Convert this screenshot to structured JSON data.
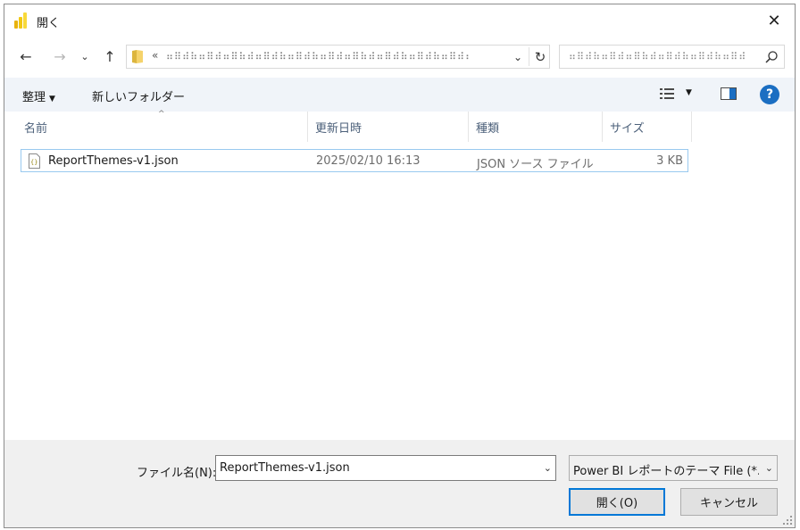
{
  "window": {
    "title": "開く"
  },
  "titlebar": {
    "close_glyph": "✕"
  },
  "nav": {
    "back_glyph": "←",
    "forward_glyph": "→",
    "recent_glyph": "⌄",
    "up_glyph": "↑",
    "address_chevron": "«",
    "address_path": "⠶⠿⠾⠷⠶⠿⠾⠶⠿⠷⠾⠶⠿⠾⠷⠶⠿⠾⠷⠶⠿⠾⠶⠿⠷⠾⠶⠿⠾⠷⠶⠿⠾⠷⠶⠿⠾⠶⠿⠷⠾⠶⠿⠾⠷⠶",
    "address_dropdown_glyph": "⌄",
    "refresh_glyph": "↻",
    "search_text": "⠶⠿⠾⠷⠶⠿⠾⠶⠿⠷⠾⠶⠿⠾⠷⠶⠿⠾⠷⠶⠿⠾⠶⠿⠷⠾⠶"
  },
  "command_bar": {
    "organize_label": "整理",
    "new_folder_label": "新しいフォルダー",
    "help_glyph": "?"
  },
  "file_list": {
    "columns": {
      "name": "名前",
      "date": "更新日時",
      "type": "種類",
      "size": "サイズ"
    },
    "sort_glyph": "^",
    "rows": [
      {
        "name": "ReportThemes-v1.json",
        "date": "2025/02/10 16:13",
        "type": "JSON ソース ファイル",
        "size": "3 KB"
      }
    ]
  },
  "bottom": {
    "filename_label": "ファイル名(N):",
    "filename_value": "ReportThemes-v1.json",
    "filter_value": "Power BI レポートのテーマ File (*.json)",
    "dropdown_glyph": "⌄",
    "open_button": "開く(O)",
    "cancel_button": "キャンセル"
  },
  "colors": {
    "accent": "#0078d7",
    "help": "#1b6ec2",
    "powerbi_yellow": "#f2c811",
    "selection_border": "#99c9ef"
  }
}
